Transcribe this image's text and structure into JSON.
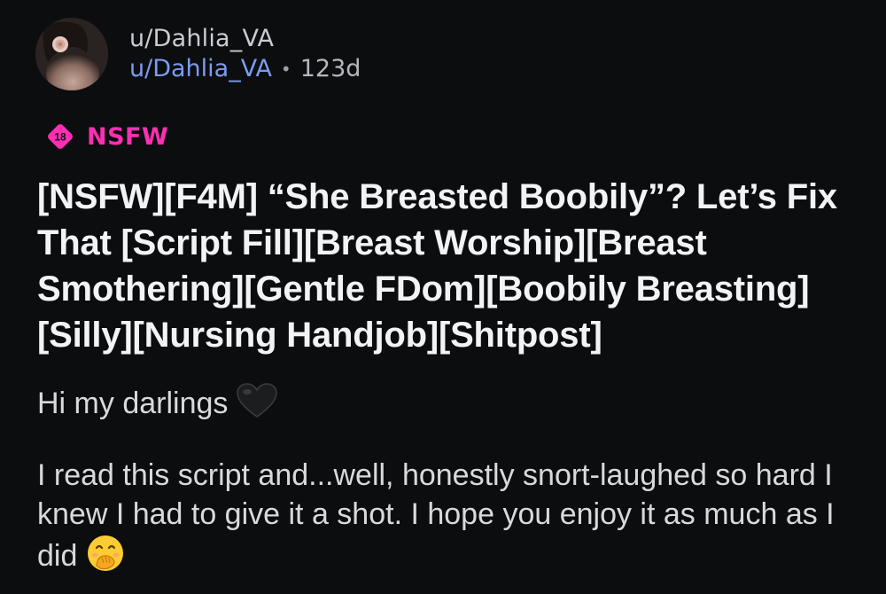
{
  "post": {
    "author_display": "u/Dahlia_VA",
    "author_link": "u/Dahlia_VA",
    "separator": "•",
    "age": "123d",
    "avatar_icon": "profile-avatar",
    "flair": {
      "badge_text": "18",
      "label": "NSFW",
      "color": "#ff2fb2"
    },
    "title": "[NSFW][F4M] “She Breasted Boobily”? Let’s Fix That [Script Fill][Breast Worship][Breast Smothering][Gentle FDom][Boobily Breasting][Silly][Nursing Handjob][Shitpost]",
    "body": {
      "paragraph_1": "Hi my darlings",
      "paragraph_1_emoji": "black-heart-icon",
      "paragraph_2": "I read this script and...well, honestly snort-laughed so hard I knew I had to give it a shot. I hope you enjoy it as much as I did",
      "paragraph_2_emoji": "face-with-hand-over-mouth-icon"
    }
  },
  "colors": {
    "background": "#0b0d0f",
    "link": "#7b9cf0",
    "nsfw": "#ff2fb2",
    "title": "#f1f3f4"
  }
}
